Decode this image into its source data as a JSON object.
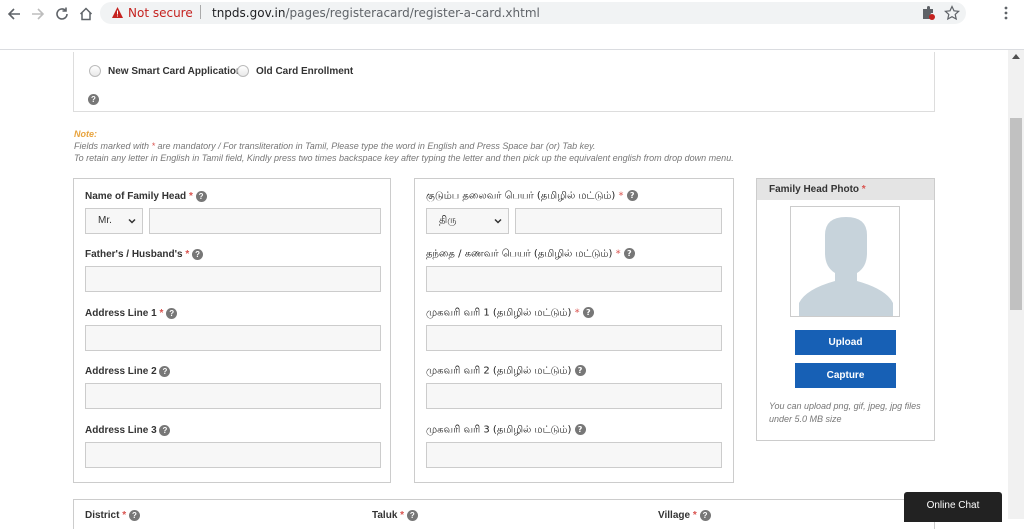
{
  "browser": {
    "security_label": "Not secure",
    "url_domain": "tnpds.gov.in",
    "url_path": "/pages/registeracard/register-a-card.xhtml"
  },
  "application_type": {
    "options": [
      "New Smart Card Application",
      "Old Card Enrollment"
    ]
  },
  "note": {
    "title": "Note:",
    "line1_a": "Fields marked with ",
    "line1_star": "*",
    "line1_b": " are mandatory  / For transliteration in Tamil, Please type the word in English and Press Space bar (or) Tab key.",
    "line2": "To retain any letter in English in Tamil field, Kindly press two times backspace key after typing the letter and then pick up the equivalent english from drop down menu."
  },
  "english_form": {
    "family_head_label": "Name of Family Head",
    "title_select_value": "Mr.",
    "father_husband_label": "Father's / Husband's",
    "address1_label": "Address Line 1",
    "address2_label": "Address Line 2",
    "address3_label": "Address Line 3"
  },
  "tamil_form": {
    "family_head_label": "குடும்ப தலைவர் பெயர் (தமிழில் மட்டும்)",
    "title_select_value": "திரு",
    "father_husband_label": "தந்தை / கணவர் பெயர் (தமிழில் மட்டும்)",
    "address1_label": "முகவரி வரி 1 (தமிழில் மட்டும்)",
    "address2_label": "முகவரி வரி 2 (தமிழில் மட்டும்)",
    "address3_label": "முகவரி வரி 3 (தமிழில் மட்டும்)"
  },
  "photo": {
    "header": "Family Head Photo",
    "upload_label": "Upload",
    "capture_label": "Capture",
    "note": "You can upload png, gif, jpeg, jpg files under 5.0 MB size"
  },
  "location": {
    "district_label": "District",
    "taluk_label": "Taluk",
    "village_label": "Village"
  },
  "chat": {
    "label": "Online Chat"
  },
  "mandatory_marker": "*",
  "help_glyph": "?",
  "colors": {
    "accent": "#1760b5",
    "required": "#d9534f",
    "note_title": "#e8a33d",
    "warning": "#c5221f"
  }
}
